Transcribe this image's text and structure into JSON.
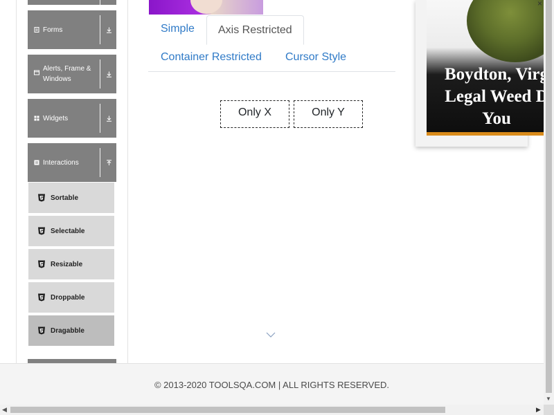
{
  "sidebar": {
    "groups": [
      {
        "label": "Forms",
        "icon": "document-icon",
        "arrow": "download-icon"
      },
      {
        "label": "Alerts, Frame & Windows",
        "icon": "window-icon",
        "arrow": "download-icon"
      },
      {
        "label": "Widgets",
        "icon": "grid-icon",
        "arrow": "download-icon"
      },
      {
        "label": "Interactions",
        "icon": "list-icon",
        "arrow": "upload-icon"
      }
    ],
    "items": [
      {
        "label": "Sortable",
        "icon": "html5-icon"
      },
      {
        "label": "Selectable",
        "icon": "html5-icon"
      },
      {
        "label": "Resizable",
        "icon": "html5-icon"
      },
      {
        "label": "Droppable",
        "icon": "html5-icon"
      },
      {
        "label": "Dragabble",
        "icon": "html5-icon",
        "active": true
      }
    ]
  },
  "tabs": {
    "simple": "Simple",
    "axis_restricted": "Axis Restricted",
    "container_restricted": "Container Restricted",
    "cursor_style": "Cursor Style",
    "active": "Axis Restricted"
  },
  "draggables": {
    "only_x": "Only X",
    "only_y": "Only Y"
  },
  "ad": {
    "line1": "Boydton, Virg",
    "line2": "Legal Weed D",
    "line3": "You"
  },
  "footer": {
    "text": "© 2013-2020 TOOLSQA.COM | ALL RIGHTS RESERVED."
  },
  "colors": {
    "tab_link": "#2f7ac7",
    "sidebar_group": "#808080",
    "sidebar_item": "#d9d9d9",
    "sidebar_item_active": "#bdbdbd"
  }
}
